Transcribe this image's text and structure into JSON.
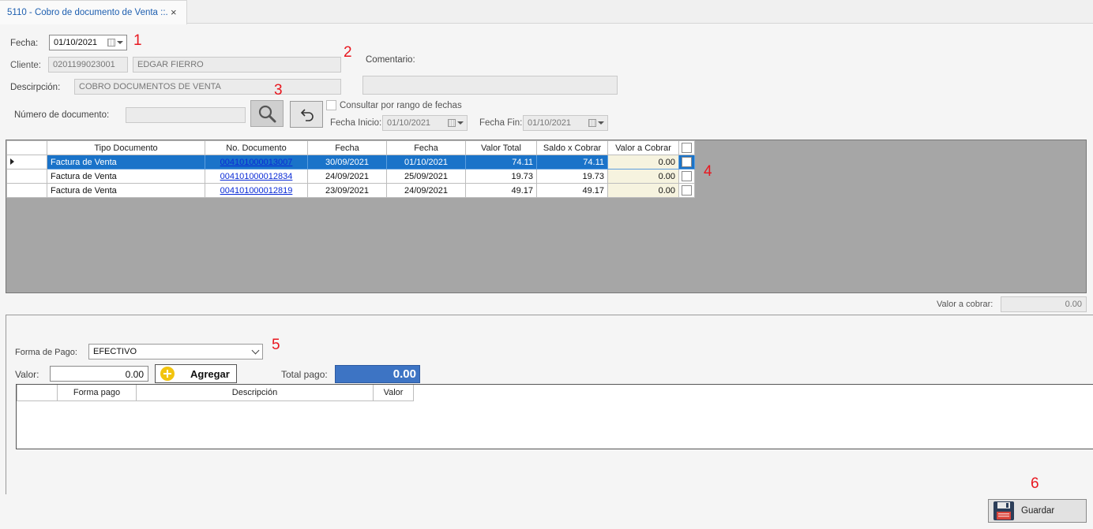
{
  "tab": {
    "title": "5110 - Cobro de documento de Venta ::.",
    "close": "×"
  },
  "header": {
    "fecha_label": "Fecha:",
    "fecha_value": "01/10/2021",
    "cliente_label": "Cliente:",
    "cliente_code": "0201199023001",
    "cliente_name": "EDGAR FIERRO",
    "descripcion_label": "Descirpción:",
    "descripcion_value": "COBRO DOCUMENTOS DE VENTA",
    "comentario_label": "Comentario:",
    "comentario_value": "",
    "numero_label": "Número de documento:",
    "numero_value": "",
    "rango_label": "Consultar por rango de fechas",
    "fecha_inicio_label": "Fecha Inicio:",
    "fecha_inicio_value": "01/10/2021",
    "fecha_fin_label": "Fecha Fin:",
    "fecha_fin_value": "01/10/2021"
  },
  "markers": [
    "1",
    "2",
    "3",
    "4",
    "5",
    "6"
  ],
  "documents": {
    "columns": [
      "Tipo Documento",
      "No. Documento",
      "Fecha",
      "Fecha",
      "Valor Total",
      "Saldo x Cobrar",
      "Valor a Cobrar"
    ],
    "rows": [
      {
        "tipo": "Factura de Venta",
        "numero": "004101000013007",
        "fecha1": "30/09/2021",
        "fecha2": "01/10/2021",
        "total": "74.11",
        "saldo": "74.11",
        "cobrar": "0.00",
        "selected": true
      },
      {
        "tipo": "Factura de Venta",
        "numero": "004101000012834",
        "fecha1": "24/09/2021",
        "fecha2": "25/09/2021",
        "total": "19.73",
        "saldo": "19.73",
        "cobrar": "0.00",
        "selected": false
      },
      {
        "tipo": "Factura de Venta",
        "numero": "004101000012819",
        "fecha1": "23/09/2021",
        "fecha2": "24/09/2021",
        "total": "49.17",
        "saldo": "49.17",
        "cobrar": "0.00",
        "selected": false
      }
    ]
  },
  "valor_a_cobrar": {
    "label": "Valor a cobrar:",
    "value": "0.00"
  },
  "pago": {
    "forma_label": "Forma de Pago:",
    "forma_value": "EFECTIVO",
    "valor_label": "Valor:",
    "valor_value": "0.00",
    "agregar_label": "Agregar",
    "total_label": "Total pago:",
    "total_value": "0.00",
    "columns": [
      "Forma pago",
      "Descripción",
      "Valor"
    ]
  },
  "footer": {
    "guardar_label": "Guardar"
  },
  "colors": {
    "selected_row": "#1a73c9",
    "total_box": "#3d74c4",
    "marker": "#e8171f",
    "link": "#0a2bd6"
  },
  "icons": [
    "close-icon",
    "calendar-icon",
    "search-icon",
    "undo-icon",
    "row-indicator-icon",
    "plus-circle-icon",
    "save-disk-icon"
  ]
}
